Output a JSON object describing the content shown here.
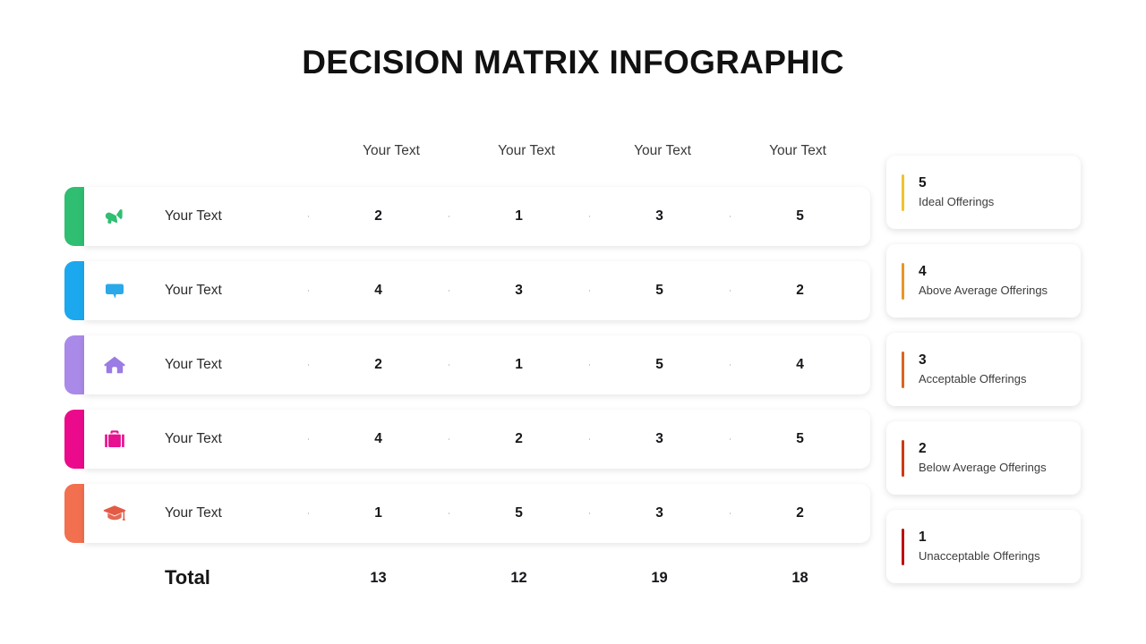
{
  "title": "DECISION MATRIX INFOGRAPHIC",
  "matrix": {
    "column_headers": [
      "Your Text",
      "Your Text",
      "Your Text",
      "Your Text"
    ],
    "rows": [
      {
        "label": "Your Text",
        "icon": "megaphone-icon",
        "accent_color": "#2FBE72",
        "icon_color": "#2FBE72",
        "values": [
          2,
          1,
          3,
          5
        ]
      },
      {
        "label": "Your Text",
        "icon": "speech-bubble-icon",
        "accent_color": "#1BA8EE",
        "icon_color": "#2BA8E8",
        "values": [
          4,
          3,
          5,
          2
        ]
      },
      {
        "label": "Your Text",
        "icon": "house-icon",
        "accent_color": "#A98AE8",
        "icon_color": "#9B7BE4",
        "values": [
          2,
          1,
          5,
          4
        ]
      },
      {
        "label": "Your Text",
        "icon": "briefcase-icon",
        "accent_color": "#EC0A8C",
        "icon_color": "#E6128F",
        "values": [
          4,
          2,
          3,
          5
        ]
      },
      {
        "label": "Your Text",
        "icon": "graduation-cap-icon",
        "accent_color": "#F2704F",
        "icon_color": "#E35B45",
        "values": [
          1,
          5,
          3,
          2
        ]
      }
    ],
    "total_label": "Total",
    "totals": [
      13,
      12,
      19,
      18
    ]
  },
  "legend": {
    "items": [
      {
        "score": "5",
        "label": "Ideal Offerings",
        "color": "#F2C230"
      },
      {
        "score": "4",
        "label": "Above Average Offerings",
        "color": "#EA9527"
      },
      {
        "score": "3",
        "label": "Acceptable Offerings",
        "color": "#DC6420"
      },
      {
        "score": "2",
        "label": "Below Average Offerings",
        "color": "#CC3A14"
      },
      {
        "score": "1",
        "label": "Unacceptable Offerings",
        "color": "#BE0F12"
      }
    ]
  },
  "chart_data": {
    "type": "table",
    "title": "DECISION MATRIX INFOGRAPHIC",
    "categories": [
      "Your Text",
      "Your Text",
      "Your Text",
      "Your Text"
    ],
    "series": [
      {
        "name": "Your Text",
        "values": [
          2,
          1,
          3,
          5
        ]
      },
      {
        "name": "Your Text",
        "values": [
          4,
          3,
          5,
          2
        ]
      },
      {
        "name": "Your Text",
        "values": [
          2,
          1,
          5,
          4
        ]
      },
      {
        "name": "Your Text",
        "values": [
          4,
          2,
          3,
          5
        ]
      },
      {
        "name": "Your Text",
        "values": [
          1,
          5,
          3,
          2
        ]
      }
    ],
    "totals": [
      13,
      12,
      19,
      18
    ],
    "scale": {
      "5": "Ideal Offerings",
      "4": "Above Average Offerings",
      "3": "Acceptable Offerings",
      "2": "Below Average Offerings",
      "1": "Unacceptable Offerings"
    }
  }
}
